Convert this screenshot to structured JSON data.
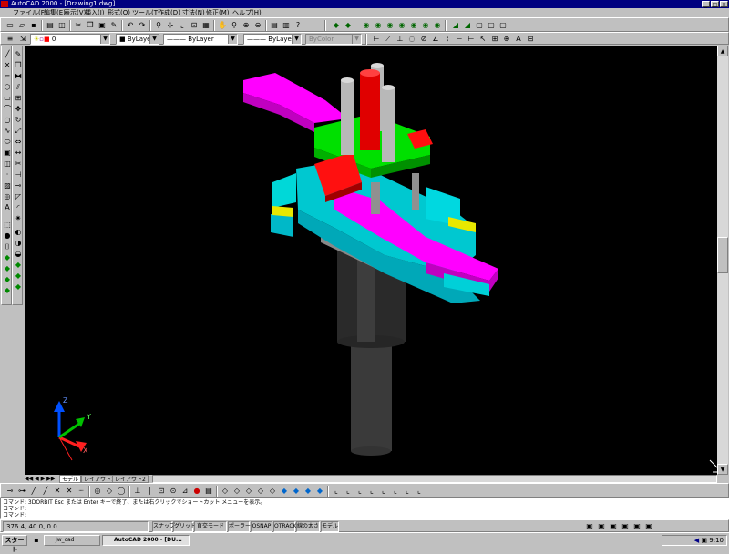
{
  "window": {
    "title": "AutoCAD 2000 - [Drawing1.dwg]",
    "controls": [
      "_",
      "□",
      "×"
    ]
  },
  "menu": {
    "items": [
      "ファイル(F)",
      "編集(E)",
      "表示(V)",
      "挿入(I)",
      "形式(O)",
      "ツール(T)",
      "作成(D)",
      "寸法(N)",
      "修正(M)",
      "ヘルプ(H)"
    ]
  },
  "toolbar": {
    "icons_row1": [
      "new-icon",
      "open-icon",
      "save-icon",
      "print-icon",
      "preview-icon",
      "cut-icon",
      "copy-icon",
      "paste-icon",
      "matchprop-icon",
      "undo-icon",
      "redo-icon",
      "hyperlink-icon",
      "snap-icon",
      "ucs-icon",
      "osnap-icon",
      "redraw-icon",
      "pan-icon",
      "zoom-realtime-icon",
      "zoom-window-icon",
      "zoom-prev-icon",
      "properties-icon",
      "designcenter-icon",
      "help-icon"
    ],
    "layer_combo": "0",
    "color_combo": "ByLayer",
    "linetype_combo": "ByLayer",
    "lineweight_combo": "ByLayer",
    "plotstyle_combo": "ByColor"
  },
  "drawing": {
    "ucs_labels": [
      "X",
      "Y",
      "Z"
    ],
    "background": "#000000"
  },
  "tabs": {
    "items": [
      "モデル",
      "レイアウト1",
      "レイアウト2"
    ]
  },
  "command": {
    "lines": [
      "コマンド: 3DORBIT Esc または Enter キーで終了、または右クリックでショートカット メニューを表示。",
      "コマンド:",
      "コマンド:"
    ]
  },
  "status": {
    "coords": "376.4, 40.0, 0.0",
    "buttons": [
      "スナップ",
      "グリッド",
      "直交モード",
      "ポーラー",
      "OSNAP",
      "OTRACK",
      "線の太さ",
      "モデル"
    ]
  },
  "taskbar": {
    "start": "スタート",
    "tasks": [
      "Jw_cad",
      "AutoCAD 2000 - [DU..."
    ],
    "clock": "9:10"
  }
}
